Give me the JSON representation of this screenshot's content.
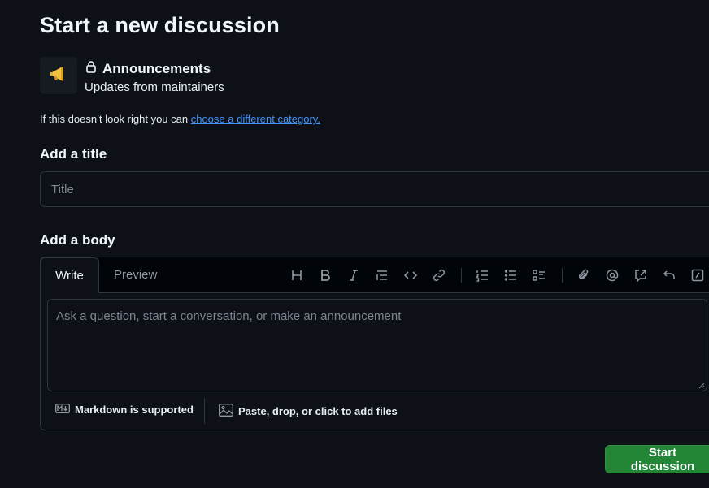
{
  "page": {
    "title": "Start a new discussion"
  },
  "category": {
    "icon": "megaphone-icon",
    "lock_icon": "lock-icon",
    "name": "Announcements",
    "description": "Updates from maintainers",
    "hint_prefix": "If this doesn’t look right you can ",
    "hint_link": "choose a different category."
  },
  "title_section": {
    "label": "Add a title",
    "placeholder": "Title",
    "value": ""
  },
  "body_section": {
    "label": "Add a body",
    "tabs": [
      {
        "label": "Write",
        "selected": true
      },
      {
        "label": "Preview",
        "selected": false
      }
    ],
    "toolbar": [
      "heading-icon",
      "bold-icon",
      "italic-icon",
      "quote-icon",
      "code-icon",
      "link-icon",
      "numbered-list-icon",
      "unordered-list-icon",
      "task-list-icon",
      "attach-icon",
      "mention-icon",
      "reference-icon",
      "undo-icon",
      "slash-command-icon"
    ],
    "placeholder": "Ask a question, start a conversation, or make an announcement",
    "value": "",
    "markdown_note": "Markdown is supported",
    "attach_note": "Paste, drop, or click to add files"
  },
  "actions": {
    "submit_label": "Start discussion"
  },
  "colors": {
    "background": "#0d1117",
    "link": "#4493f8",
    "primary_button": "#238636",
    "megaphone": "#f0c040"
  }
}
